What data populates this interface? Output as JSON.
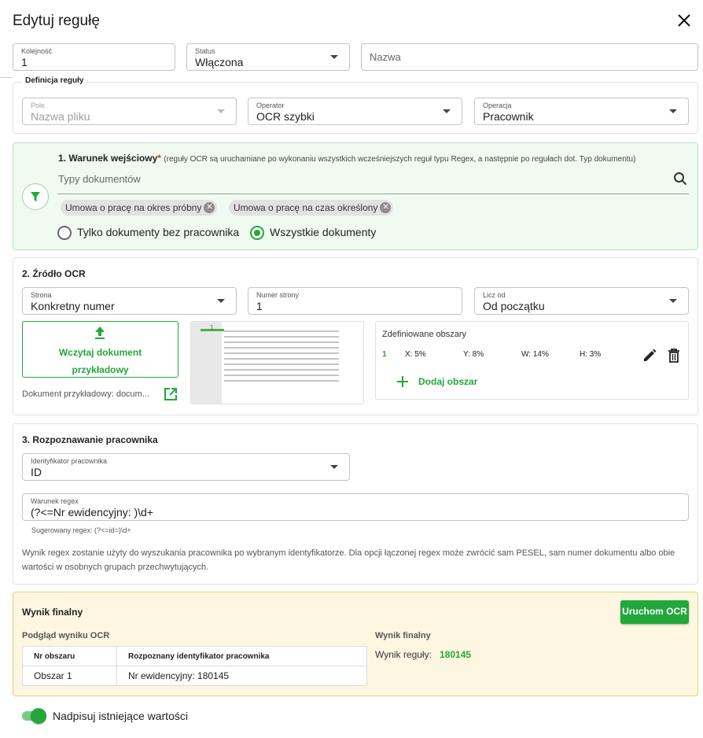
{
  "dialog": {
    "title": "Edytuj regułę"
  },
  "top": {
    "kolejnosc": {
      "label": "Kolejność",
      "value": "1"
    },
    "status": {
      "label": "Status",
      "value": "Włączona"
    },
    "nazwa": {
      "placeholder": "Nazwa"
    }
  },
  "definicja": {
    "legend": "Definicja reguły",
    "pole": {
      "label": "Pole",
      "value": "Nazwa pliku"
    },
    "operator": {
      "label": "Operator",
      "value": "OCR szybki"
    },
    "operacja": {
      "label": "Operacja",
      "value": "Pracownik"
    }
  },
  "warunek": {
    "title": "1. Warunek wejściowy",
    "required_mark": "*",
    "note": "(reguły OCR są uruchamiane po wykonaniu wszystkich wcześniejszych reguł typu Regex, a następnie po regułach dot. Typ dokumentu)",
    "search_placeholder": "Typy dokumentów",
    "chips": [
      "Umowa o pracę na okres próbny",
      "Umowa o pracę na czas określony"
    ],
    "radio_1": "Tylko dokumenty bez pracownika",
    "radio_2": "Wszystkie dokumenty",
    "selected": 2
  },
  "zrodlo": {
    "title": "2. Źródło OCR",
    "strona": {
      "label": "Strona",
      "value": "Konkretny numer"
    },
    "numer_strony": {
      "label": "Numer strony",
      "value": "1"
    },
    "licz_od": {
      "label": "Licz od",
      "value": "Od początku"
    },
    "upload_label_1": "Wczytaj dokument",
    "upload_label_2": "przykładowy",
    "sample_doc": "Dokument przykładowy: docum...",
    "thumb_marker": "1",
    "areas_title": "Zdefiniowane obszary",
    "areas": [
      {
        "nr": "1",
        "x": "X: 5%",
        "y": "Y: 8%",
        "w": "W: 14%",
        "h": "H: 3%"
      }
    ],
    "add_area": "Dodaj obszar"
  },
  "rozpoznawanie": {
    "title": "3. Rozpoznawanie pracownika",
    "identyfikator": {
      "label": "Identyfikator pracownika",
      "value": "ID"
    },
    "regex": {
      "label": "Warunek regex",
      "value": "(?<=Nr ewidencyjny: )\\d+"
    },
    "suggested": "Sugerowany regex: (?<=id=)\\d+",
    "help": "Wynik regex zostanie użyty do wyszukania pracownika po wybranym identyfikatorze. Dla opcji łączonej regex może zwrócić sam PESEL, sam numer dokumentu albo obie wartości w osobnych grupach przechwytujących."
  },
  "wynik": {
    "title": "Wynik finalny",
    "run_button": "Uruchom OCR",
    "preview_title": "Podgląd wyniku OCR",
    "table_headers": [
      "Nr obszaru",
      "Rozpoznany identyfikator pracownika"
    ],
    "table_rows": [
      [
        "Obszar 1",
        "Nr ewidencyjny: 180145"
      ]
    ],
    "final_title": "Wynik finalny",
    "final_label": "Wynik reguły:",
    "final_value": "180145"
  },
  "toggle": {
    "label": "Nadpisuj istniejące wartości",
    "on": true
  },
  "colors": {
    "accent": "#22a83a",
    "green_bg": "#f0faf0",
    "yellow_bg": "#fdf7e1",
    "yellow_border": "#e8cf6e"
  }
}
